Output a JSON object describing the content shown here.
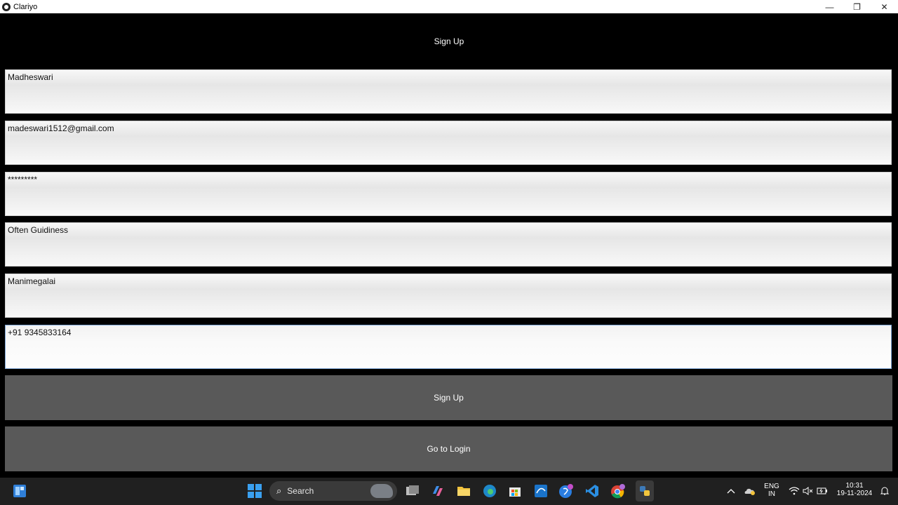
{
  "window": {
    "title": "Clariyo",
    "controls": {
      "minimize": "—",
      "restore": "❐",
      "close": "✕"
    }
  },
  "header": {
    "title": "Sign Up"
  },
  "form": {
    "name": "Madheswari",
    "email": "madeswari1512@gmail.com",
    "password": "*********",
    "field4": "Often Guidiness",
    "field5": "Manimegalai",
    "phone": "+91 9345833164"
  },
  "buttons": {
    "signup": "Sign Up",
    "login": "Go to Login"
  },
  "taskbar": {
    "search_label": "Search",
    "lang_line1": "ENG",
    "lang_line2": "IN",
    "time": "10:31",
    "date": "19-11-2024"
  },
  "colors": {
    "accent": "#7fa6d6",
    "button": "#595959",
    "background": "#000000"
  }
}
